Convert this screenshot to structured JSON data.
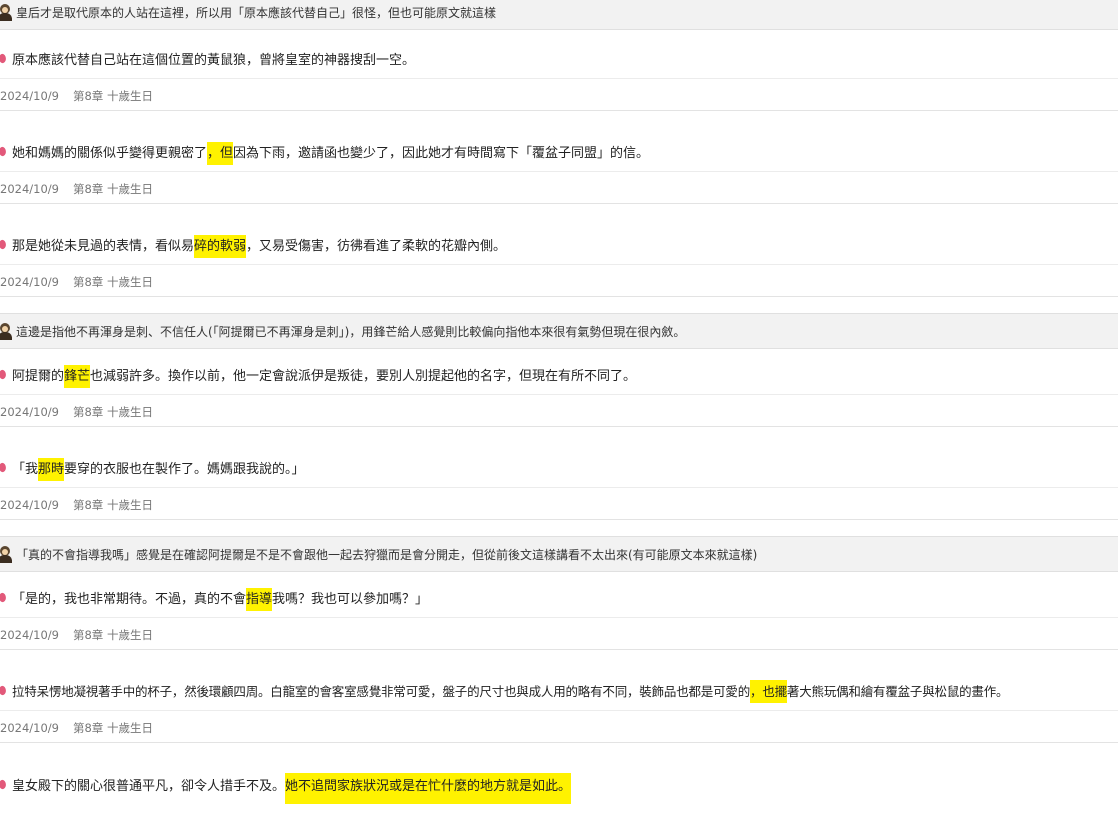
{
  "comments": [
    "皇后才是取代原本的人站在這裡，所以用「原本應該代替自己」很怪，但也可能原文就這樣",
    "這邊是指他不再渾身是刺、不信任人(「阿提爾已不再渾身是刺」)，用鋒芒給人感覺則比較偏向指他本來很有氣勢但現在很內斂。",
    "「真的不會指導我嗎」感覺是在確認阿提爾是不是不會跟他一起去狩獵而是會分開走，但從前後文這樣講看不太出來(有可能原文本來就這樣)"
  ],
  "quotes": [
    {
      "segments": [
        "原本應該代替自己站在這個位置的黃鼠狼，曾將皇室的神器搜刮一空。"
      ]
    },
    {
      "segments": [
        "她和媽媽的關係似乎變得更親密了",
        "，但",
        "因為下雨，邀請函也變少了，因此她才有時間寫下「覆盆子同盟」的信。"
      ]
    },
    {
      "segments": [
        "那是她從未見過的表情，看似易",
        "碎的軟弱",
        "，又易受傷害，彷彿看進了柔軟的花瓣內側。"
      ]
    },
    {
      "segments": [
        "阿提爾的",
        "鋒芒",
        "也減弱許多。換作以前，他一定會說派伊是叛徒，要別人別提起他的名字，但現在有所不同了。"
      ]
    },
    {
      "segments": [
        "「我",
        "那時",
        "要穿的衣服也在製作了。媽媽跟我說的。」"
      ]
    },
    {
      "segments": [
        "「是的，我也非常期待。不過，真的不會",
        "指導",
        "我嗎？我也可以參加嗎？」"
      ]
    },
    {
      "segments": [
        "拉特呆愣地凝視著手中的杯子，然後環顧四周。白龍室的會客室感覺非常可愛，盤子的尺寸也與成人用的略有不同，裝飾品也都是可愛的",
        "，也擺",
        "著大熊玩偶和繪有覆盆子與松鼠的畫作。"
      ]
    },
    {
      "segments": [
        "皇女殿下的關心很普通平凡，卻令人措手不及。",
        "她不追問家族狀況或是在忙什麼的地方就是如此。"
      ]
    }
  ],
  "meta": {
    "date": "2024/10/9",
    "chapter": "第8章 十歲生日"
  }
}
